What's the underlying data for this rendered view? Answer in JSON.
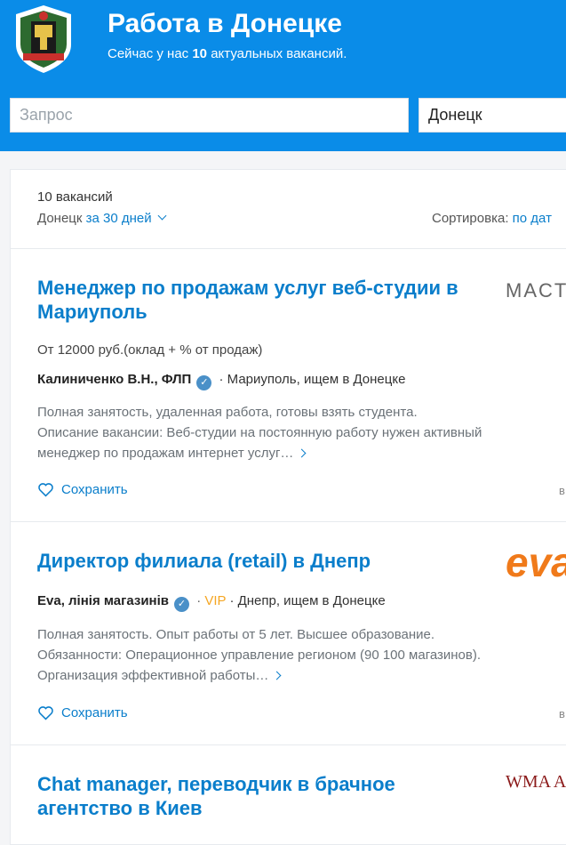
{
  "header": {
    "title": "Работа в Донецке",
    "subtitle_prefix": "Сейчас у нас",
    "subtitle_count": "10",
    "subtitle_suffix": "актуальных вакансий.",
    "query_placeholder": "Запрос",
    "city_value": "Донецк",
    "colors": {
      "header_bg": "#0a8ce8",
      "link": "#0a7ecb"
    }
  },
  "results": {
    "count": "10 вакансий",
    "city": "Донецк",
    "period": "за 30 дней",
    "sort_label": "Сортировка:",
    "sort_value": "по дат"
  },
  "jobs": [
    {
      "title": "Менеджер по продажам услуг веб-студии в Мариуполь",
      "salary": "От 12000 руб.(оклад + % от продаж)",
      "company": "Калиниченко В.Н., ФЛП",
      "verified_icon": "check",
      "location": "· Мариуполь, ищем в Донецке",
      "desc_lines": [
        "Полная занятость, удаленная работа, готовы взять студента.",
        "Описание вакансии: Веб-студии на постоянную работу нужен активный",
        "менеджер по продажам интернет услуг…"
      ],
      "save_label": "Сохранить",
      "right_cut": "в",
      "logo_text": "MACT"
    },
    {
      "title": "Директор филиала (retail) в Днепр",
      "company": "Eva, лінія магазинів",
      "verified_icon": "check",
      "vip": "VIP",
      "location": "· Днепр, ищем в Донецке",
      "desc_lines": [
        "Полная занятость. Опыт работы от 5 лет. Высшее образование.",
        "Обязанности: Операционное управление регионом (90 100 магазинов).",
        "Организация эффективной работы…"
      ],
      "save_label": "Сохранить",
      "right_cut": "в",
      "logo_text": "eva"
    },
    {
      "title": "Chat manager, переводчик в брачное агентство в Киев",
      "logo_text": "WMA AGE"
    }
  ]
}
